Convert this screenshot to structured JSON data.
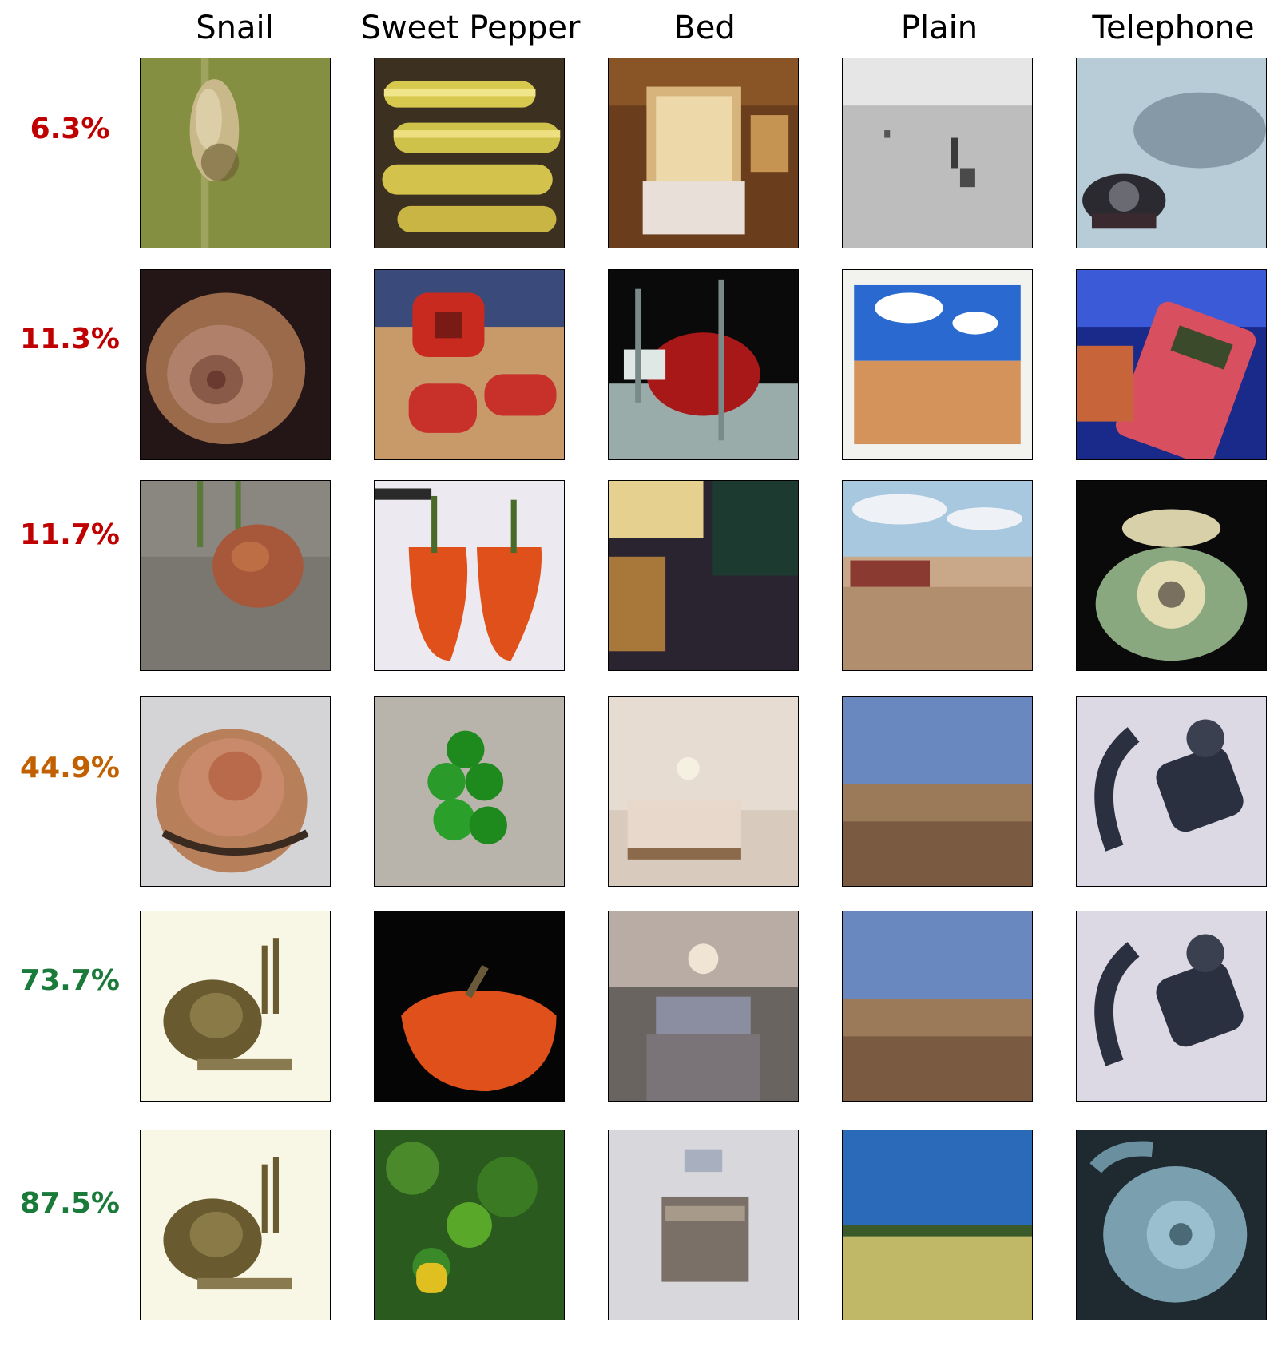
{
  "columns": [
    "Snail",
    "Sweet Pepper",
    "Bed",
    "Plain",
    "Telephone"
  ],
  "rows": [
    {
      "label": "6.3%",
      "color": "#c00000"
    },
    {
      "label": "11.3%",
      "color": "#c00000"
    },
    {
      "label": "11.7%",
      "color": "#c00000"
    },
    {
      "label": "44.9%",
      "color": "#c06000"
    },
    {
      "label": "73.7%",
      "color": "#1a7a3a"
    },
    {
      "label": "87.5%",
      "color": "#1a7a3a"
    }
  ],
  "images": [
    [
      "snail-on-stem-green-background-image",
      "sliced-yellow-peppers-image",
      "canopy-bed-room-image",
      "grayscale-plain-with-figure-image",
      "old-telephone-on-blue-gray-image"
    ],
    [
      "large-brown-snail-shell-image",
      "red-pepper-on-cutting-board-image",
      "bed-with-red-blanket-image",
      "framed-plain-with-clouds-image",
      "pink-calculator-phone-image"
    ],
    [
      "brown-snail-on-rock-image",
      "halved-orange-pepper-image",
      "dark-bedroom-corner-image",
      "plain-road-with-barn-image",
      "cream-rotary-phone-image"
    ],
    [
      "striped-snail-shell-image",
      "green-peppers-on-cloth-image",
      "bed-in-bright-room-image",
      "open-plain-blue-sky-image",
      "black-rotary-phone-image"
    ],
    [
      "snail-with-antennae-image",
      "orange-pepper-on-black-image",
      "hotel-bedroom-image",
      "open-plain-blue-sky-image",
      "black-rotary-phone-image"
    ],
    [
      "snail-with-antennae-image",
      "green-peppers-on-plant-image",
      "patterned-bed-image",
      "grassland-plain-horizon-image",
      "blue-rotary-phone-image"
    ]
  ]
}
